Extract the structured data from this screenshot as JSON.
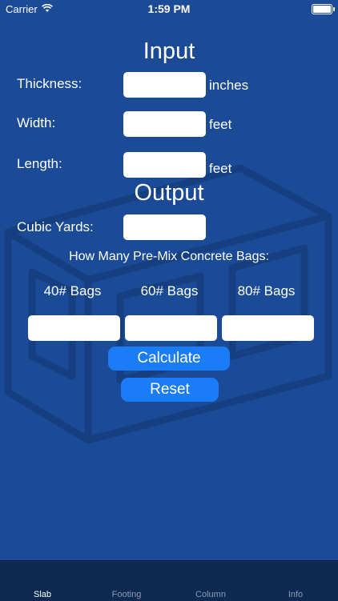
{
  "status": {
    "carrier": "Carrier",
    "time": "1:59 PM"
  },
  "input": {
    "heading": "Input",
    "thickness_label": "Thickness:",
    "thickness_unit": "inches",
    "thickness_value": "",
    "width_label": "Width:",
    "width_unit": "feet",
    "width_value": "",
    "length_label": "Length:",
    "length_unit": "feet",
    "length_value": ""
  },
  "output": {
    "heading": "Output",
    "cubic_yards_label": "Cubic Yards:",
    "cubic_yards_value": "",
    "bags_question": "How Many Pre-Mix Concrete Bags:",
    "bag_labels": [
      "40# Bags",
      "60# Bags",
      "80# Bags"
    ],
    "bag_values": [
      "",
      "",
      ""
    ]
  },
  "actions": {
    "calculate": "Calculate",
    "reset": "Reset"
  },
  "tabs": [
    {
      "label": "Slab",
      "active": true
    },
    {
      "label": "Footing",
      "active": false
    },
    {
      "label": "Column",
      "active": false
    },
    {
      "label": "Info",
      "active": false
    }
  ],
  "colors": {
    "background": "#1b4b96",
    "button": "#1a7cf6",
    "tabbar": "#0e2a52"
  }
}
